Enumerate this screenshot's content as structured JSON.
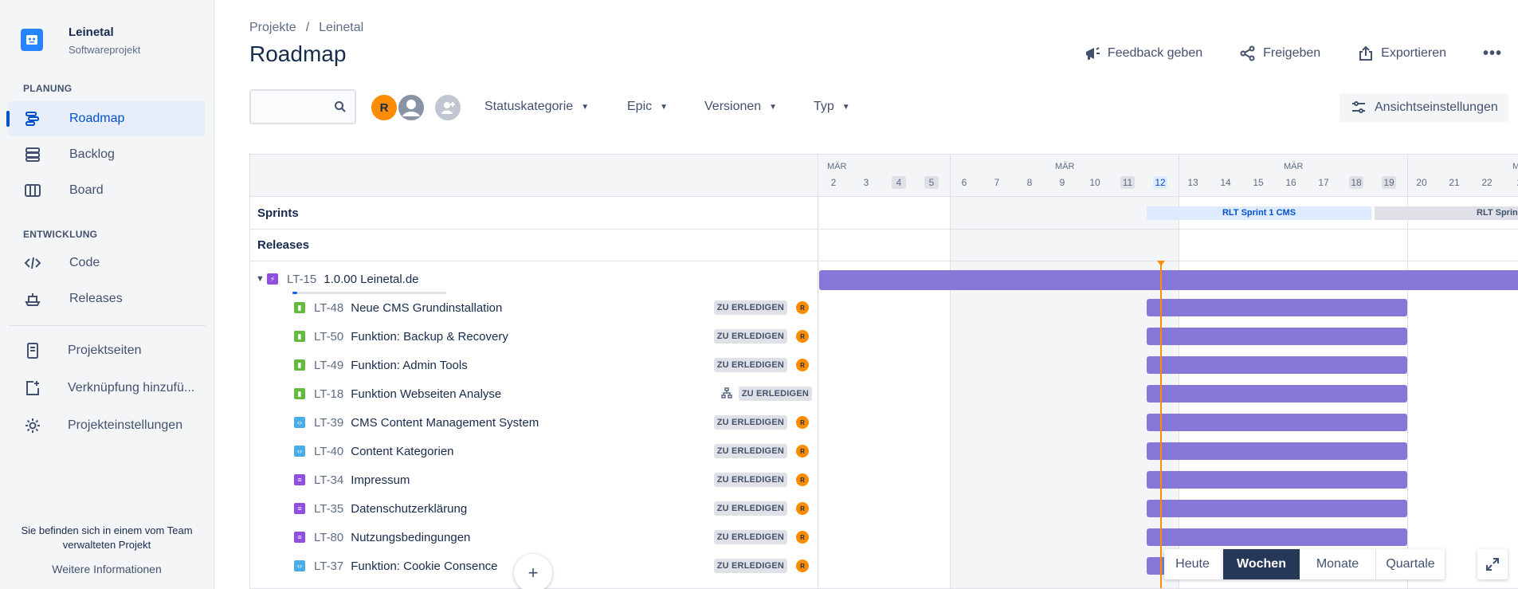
{
  "project": {
    "name": "Leinetal",
    "type": "Softwareprojekt"
  },
  "sidebar": {
    "section_planning": "PLANUNG",
    "section_dev": "ENTWICKLUNG",
    "items": [
      {
        "label": "Roadmap",
        "icon": "roadmap-icon",
        "active": true
      },
      {
        "label": "Backlog",
        "icon": "backlog-icon"
      },
      {
        "label": "Board",
        "icon": "board-icon"
      },
      {
        "label": "Code",
        "icon": "code-icon"
      },
      {
        "label": "Releases",
        "icon": "releases-icon"
      },
      {
        "label": "Projektseiten",
        "icon": "page-icon"
      },
      {
        "label": "Verknüpfung hinzufü...",
        "icon": "add-shortcut-icon"
      },
      {
        "label": "Projekteinstellungen",
        "icon": "gear-icon"
      }
    ],
    "note": "Sie befinden sich in einem vom Team verwalteten Projekt",
    "more": "Weitere Informationen"
  },
  "breadcrumb": [
    "Projekte",
    "/",
    "Leinetal"
  ],
  "page_title": "Roadmap",
  "header_actions": {
    "feedback": "Feedback geben",
    "share": "Freigeben",
    "export": "Exportieren",
    "more": "•••"
  },
  "toolbar": {
    "search_placeholder": "",
    "avatar_initial": "R",
    "filters": [
      "Statuskategorie",
      "Epic",
      "Versionen",
      "Typ"
    ],
    "view_settings": "Ansichtseinstellungen"
  },
  "bands": {
    "sprints": "Sprints",
    "releases": "Releases"
  },
  "timeline": {
    "months": [
      "MÄR",
      "MÄR",
      "MÄR",
      "M"
    ],
    "days": [
      "2",
      "3",
      "4",
      "5",
      "6",
      "7",
      "8",
      "9",
      "10",
      "11",
      "12",
      "13",
      "14",
      "15",
      "16",
      "17",
      "18",
      "19",
      "20",
      "21",
      "22",
      "2"
    ],
    "sprint1": "RLT Sprint 1 CMS",
    "sprint2": "RLT Sprin"
  },
  "epic": {
    "key": "LT-15",
    "summary": "1.0.00 Leinetal.de",
    "progress": 0.03
  },
  "issues": [
    {
      "key": "LT-48",
      "summary": "Neue CMS Grundinstallation",
      "status": "ZU ERLEDIGEN",
      "type": "story",
      "assignee": "R"
    },
    {
      "key": "LT-50",
      "summary": "Funktion: Backup & Recovery",
      "status": "ZU ERLEDIGEN",
      "type": "story",
      "assignee": "R"
    },
    {
      "key": "LT-49",
      "summary": "Funktion: Admin Tools",
      "status": "ZU ERLEDIGEN",
      "type": "story",
      "assignee": "R"
    },
    {
      "key": "LT-18",
      "summary": "Funktion Webseiten Analyse",
      "status": "ZU ERLEDIGEN",
      "type": "story",
      "assignee": ""
    },
    {
      "key": "LT-39",
      "summary": "CMS Content Management System",
      "status": "ZU ERLEDIGEN",
      "type": "task",
      "assignee": "R"
    },
    {
      "key": "LT-40",
      "summary": "Content Kategorien",
      "status": "ZU ERLEDIGEN",
      "type": "task",
      "assignee": "R"
    },
    {
      "key": "LT-34",
      "summary": "Impressum",
      "status": "ZU ERLEDIGEN",
      "type": "sub",
      "assignee": "R"
    },
    {
      "key": "LT-35",
      "summary": "Datenschutzerklärung",
      "status": "ZU ERLEDIGEN",
      "type": "sub",
      "assignee": "R"
    },
    {
      "key": "LT-80",
      "summary": "Nutzungsbedingungen",
      "status": "ZU ERLEDIGEN",
      "type": "sub",
      "assignee": "R"
    },
    {
      "key": "LT-37",
      "summary": "Funktion: Cookie Consence",
      "status": "ZU ERLEDIGEN",
      "type": "task",
      "assignee": "R"
    }
  ],
  "zoom": {
    "today": "Heute",
    "weeks": "Wochen",
    "months": "Monate",
    "quarters": "Quartale",
    "selected": "Wochen"
  },
  "colors": {
    "accent": "#0052cc",
    "bar": "#8777d9",
    "today": "#ff8b00"
  }
}
